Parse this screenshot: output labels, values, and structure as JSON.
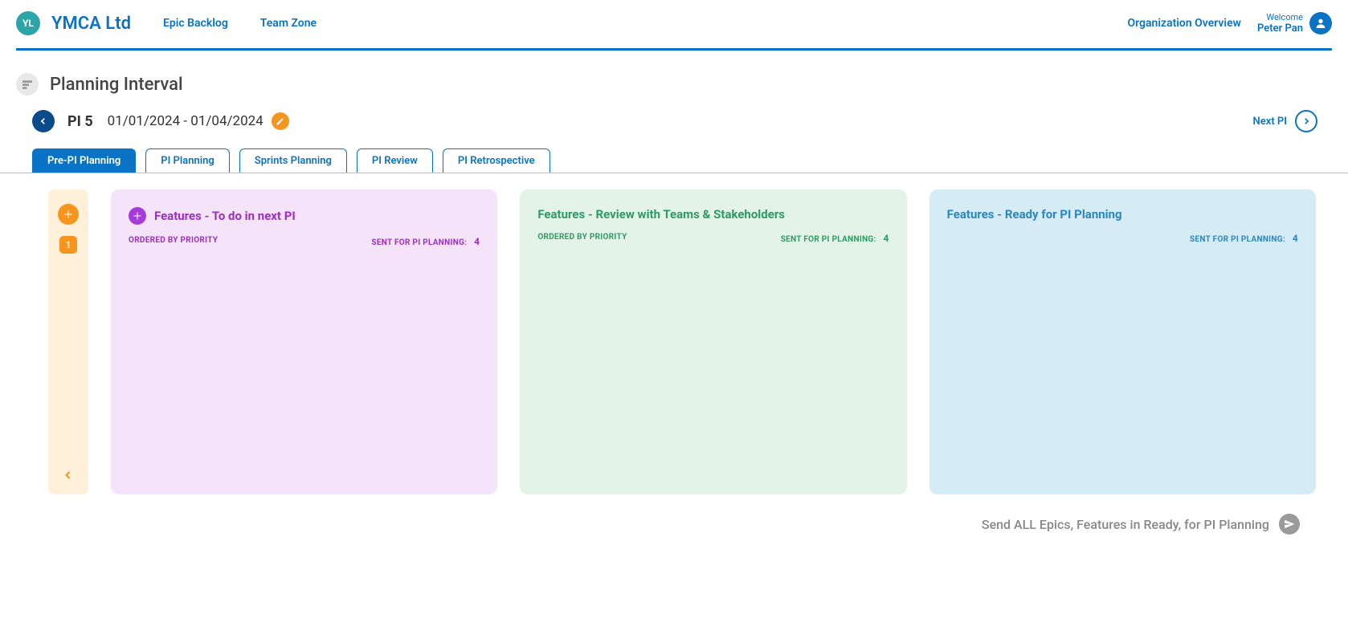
{
  "header": {
    "org_abbrev": "YL",
    "org_name": "YMCA Ltd",
    "nav": [
      {
        "label": "Epic Backlog"
      },
      {
        "label": "Team Zone"
      }
    ],
    "org_overview": "Organization Overview",
    "welcome": "Welcome",
    "user_name": "Peter Pan"
  },
  "page_title": "Planning Interval",
  "pi": {
    "label": "PI  5",
    "date_range": "01/01/2024  -  01/04/2024",
    "next_label": "Next PI"
  },
  "tabs": [
    {
      "label": "Pre-PI Planning",
      "active": true
    },
    {
      "label": "PI Planning"
    },
    {
      "label": "Sprints Planning"
    },
    {
      "label": "PI Review"
    },
    {
      "label": "PI Retrospective"
    }
  ],
  "sidebar": {
    "badge": "1"
  },
  "columns": [
    {
      "title": "Features - To do in next PI",
      "ordered_label": "ORDERED BY PRIORITY",
      "sent_label": "SENT FOR PI PLANNING:",
      "sent_count": "4",
      "has_add": true
    },
    {
      "title": "Features - Review with Teams & Stakeholders",
      "ordered_label": "ORDERED BY PRIORITY",
      "sent_label": "SENT FOR PI PLANNING:",
      "sent_count": "4",
      "has_add": false
    },
    {
      "title": "Features - Ready for PI Planning",
      "sent_label": "SENT FOR PI PLANNING:",
      "sent_count": "4",
      "has_add": false
    }
  ],
  "footer": {
    "text": "Send ALL Epics, Features in Ready, for PI Planning"
  }
}
